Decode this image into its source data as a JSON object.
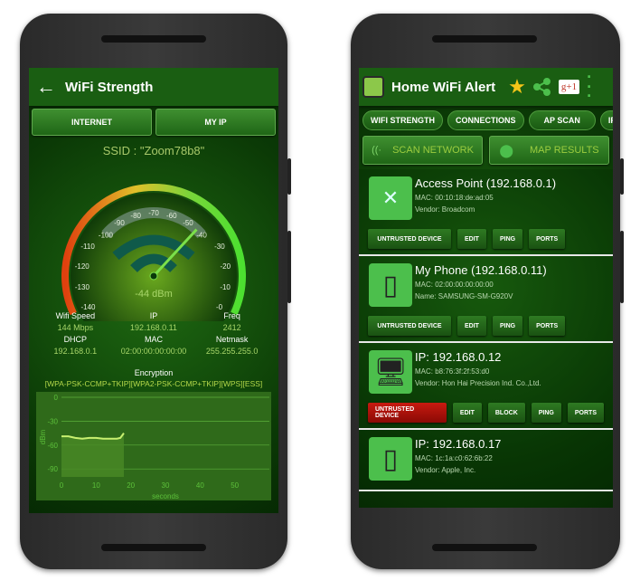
{
  "left_phone": {
    "header": {
      "title": "WiFi Strength",
      "back_icon": "arrow-left-icon"
    },
    "tabs": [
      "INTERNET",
      "MY IP"
    ],
    "ssid": "SSID : \"Zoom78b8\"",
    "gauge": {
      "ticks": [
        "-140",
        "-130",
        "-120",
        "-110",
        "-100",
        "-90",
        "-80",
        "-70",
        "-60",
        "-50",
        "-40",
        "-30",
        "-20",
        "-10",
        "-0"
      ],
      "value": -44,
      "value_label": "-44 dBm",
      "range": [
        -140,
        0
      ]
    },
    "info": [
      {
        "label": "Wifi Speed",
        "value": "144 Mbps"
      },
      {
        "label": "IP",
        "value": "192.168.0.11"
      },
      {
        "label": "Freq",
        "value": "2412"
      },
      {
        "label": "DHCP",
        "value": "192.168.0.1"
      },
      {
        "label": "MAC",
        "value": "02:00:00:00:00:00"
      },
      {
        "label": "Netmask",
        "value": "255.255.255.0"
      }
    ],
    "encryption": {
      "label": "Encryption",
      "value": "[WPA-PSK-CCMP+TKIP][WPA2-PSK-CCMP+TKIP][WPS][ESS]"
    },
    "chart_data": {
      "type": "area",
      "xlabel": "seconds",
      "ylabel": "dBm",
      "xlim": [
        0,
        60
      ],
      "ylim": [
        -100,
        0
      ],
      "x_ticks": [
        0,
        10,
        20,
        30,
        40,
        50
      ],
      "y_ticks": [
        0,
        -30,
        -60,
        -90
      ],
      "x": [
        0,
        2,
        4,
        6,
        8,
        10,
        12,
        14,
        16,
        17,
        18
      ],
      "values": [
        -49,
        -49,
        -51,
        -52,
        -51,
        -51,
        -52,
        -52,
        -52,
        -51,
        -45
      ]
    }
  },
  "right_phone": {
    "header": {
      "title": "Home WiFi Alert",
      "icons": [
        "app-logo-icon",
        "star-icon",
        "share-icon",
        "google-plus-one-icon",
        "more-vert-icon"
      ],
      "gplus_label": "g+1"
    },
    "tabs": [
      "WIFI STRENGTH",
      "CONNECTIONS",
      "AP SCAN",
      "IP"
    ],
    "actions": [
      {
        "label": "SCAN NETWORK",
        "icon": "wifi-icon"
      },
      {
        "label": "MAP RESULTS",
        "icon": "map-pin-icon"
      }
    ],
    "devices": [
      {
        "name": "Access Point (192.168.0.1)",
        "line1": "MAC: 00:10:18:de:ad:05",
        "line2": "Vendor:  Broadcom",
        "icon": "router-icon",
        "buttons": [
          "UNTRUSTED DEVICE",
          "EDIT",
          "PING",
          "PORTS"
        ],
        "untrusted_alert": false
      },
      {
        "name": "My Phone (192.168.0.11)",
        "line1": "MAC:  02:00:00:00:00:00",
        "line2": "Name: SAMSUNG-SM-G920V",
        "icon": "android-phone-icon",
        "buttons": [
          "UNTRUSTED DEVICE",
          "EDIT",
          "PING",
          "PORTS"
        ],
        "untrusted_alert": false
      },
      {
        "name": "IP: 192.168.0.12",
        "line1": "MAC:  b8:76:3f:2f:53:d0",
        "line2": "Vendor:  Hon Hai Precision Ind. Co.,Ltd.",
        "icon": "desktop-computer-icon",
        "buttons": [
          "UNTRUSTED DEVICE",
          "EDIT",
          "BLOCK",
          "PING",
          "PORTS"
        ],
        "untrusted_alert": true
      },
      {
        "name": "IP: 192.168.0.17",
        "line1": "MAC:  1c:1a:c0:62:6b:22",
        "line2": "Vendor:  Apple, Inc.",
        "icon": "iphone-icon",
        "buttons": [],
        "untrusted_alert": false
      }
    ]
  },
  "colors": {
    "accent_green": "#4cbf4c",
    "value_green": "#a8d66a",
    "alert_red": "#c81a10"
  }
}
